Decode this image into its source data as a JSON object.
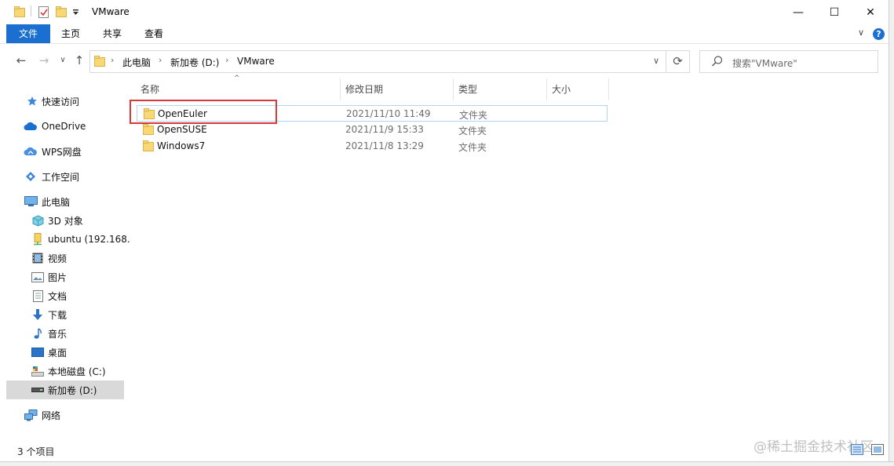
{
  "window": {
    "title": "VMware",
    "controls": {
      "minimize": "—",
      "maximize": "☐",
      "close": "✕"
    }
  },
  "ribbon": {
    "tabs": [
      {
        "label": "文件",
        "active": true
      },
      {
        "label": "主页"
      },
      {
        "label": "共享"
      },
      {
        "label": "查看"
      }
    ],
    "expand_glyph": "∨",
    "help_glyph": "?"
  },
  "nav": {
    "back": "←",
    "forward": "→",
    "recent": "∨",
    "up": "↑",
    "breadcrumb": [
      "此电脑",
      "新加卷 (D:)",
      "VMware"
    ],
    "crumb_sep": "›",
    "dropdown": "∨",
    "refresh": "⟳",
    "search_placeholder": "搜索\"VMware\""
  },
  "sidebar": {
    "items": [
      {
        "label": "快速访问",
        "icon": "star-icon"
      },
      {
        "label": "OneDrive",
        "icon": "cloud-icon"
      },
      {
        "label": "WPS网盘",
        "icon": "cloud-drive-icon"
      },
      {
        "label": "工作空间",
        "icon": "workspace-icon"
      },
      {
        "label": "此电脑",
        "icon": "computer-icon"
      },
      {
        "label": "3D 对象",
        "icon": "cube-icon"
      },
      {
        "label": "ubuntu (192.168.",
        "icon": "network-drive-icon"
      },
      {
        "label": "视频",
        "icon": "video-icon"
      },
      {
        "label": "图片",
        "icon": "picture-icon"
      },
      {
        "label": "文档",
        "icon": "document-icon"
      },
      {
        "label": "下载",
        "icon": "download-icon"
      },
      {
        "label": "音乐",
        "icon": "music-icon"
      },
      {
        "label": "桌面",
        "icon": "desktop-icon"
      },
      {
        "label": "本地磁盘 (C:)",
        "icon": "disk-icon"
      },
      {
        "label": "新加卷 (D:)",
        "icon": "drive-icon",
        "selected": true
      },
      {
        "label": "网络",
        "icon": "network-icon"
      }
    ]
  },
  "list": {
    "sort_glyph": "^",
    "columns": [
      "名称",
      "修改日期",
      "类型",
      "大小"
    ],
    "rows": [
      {
        "name": "OpenEuler",
        "date": "2021/11/10 11:49",
        "type": "文件夹",
        "size": ""
      },
      {
        "name": "OpenSUSE",
        "date": "2021/11/9 15:33",
        "type": "文件夹",
        "size": ""
      },
      {
        "name": "Windows7",
        "date": "2021/11/8 13:29",
        "type": "文件夹",
        "size": ""
      }
    ]
  },
  "status": {
    "count": "3 个项目"
  },
  "watermark": "@稀土掘金技术社区",
  "colors": {
    "accent": "#1a6fd0",
    "folder": "#f8d775",
    "annotation": "#d9393b",
    "selected_bg": "#d9d9d9"
  }
}
